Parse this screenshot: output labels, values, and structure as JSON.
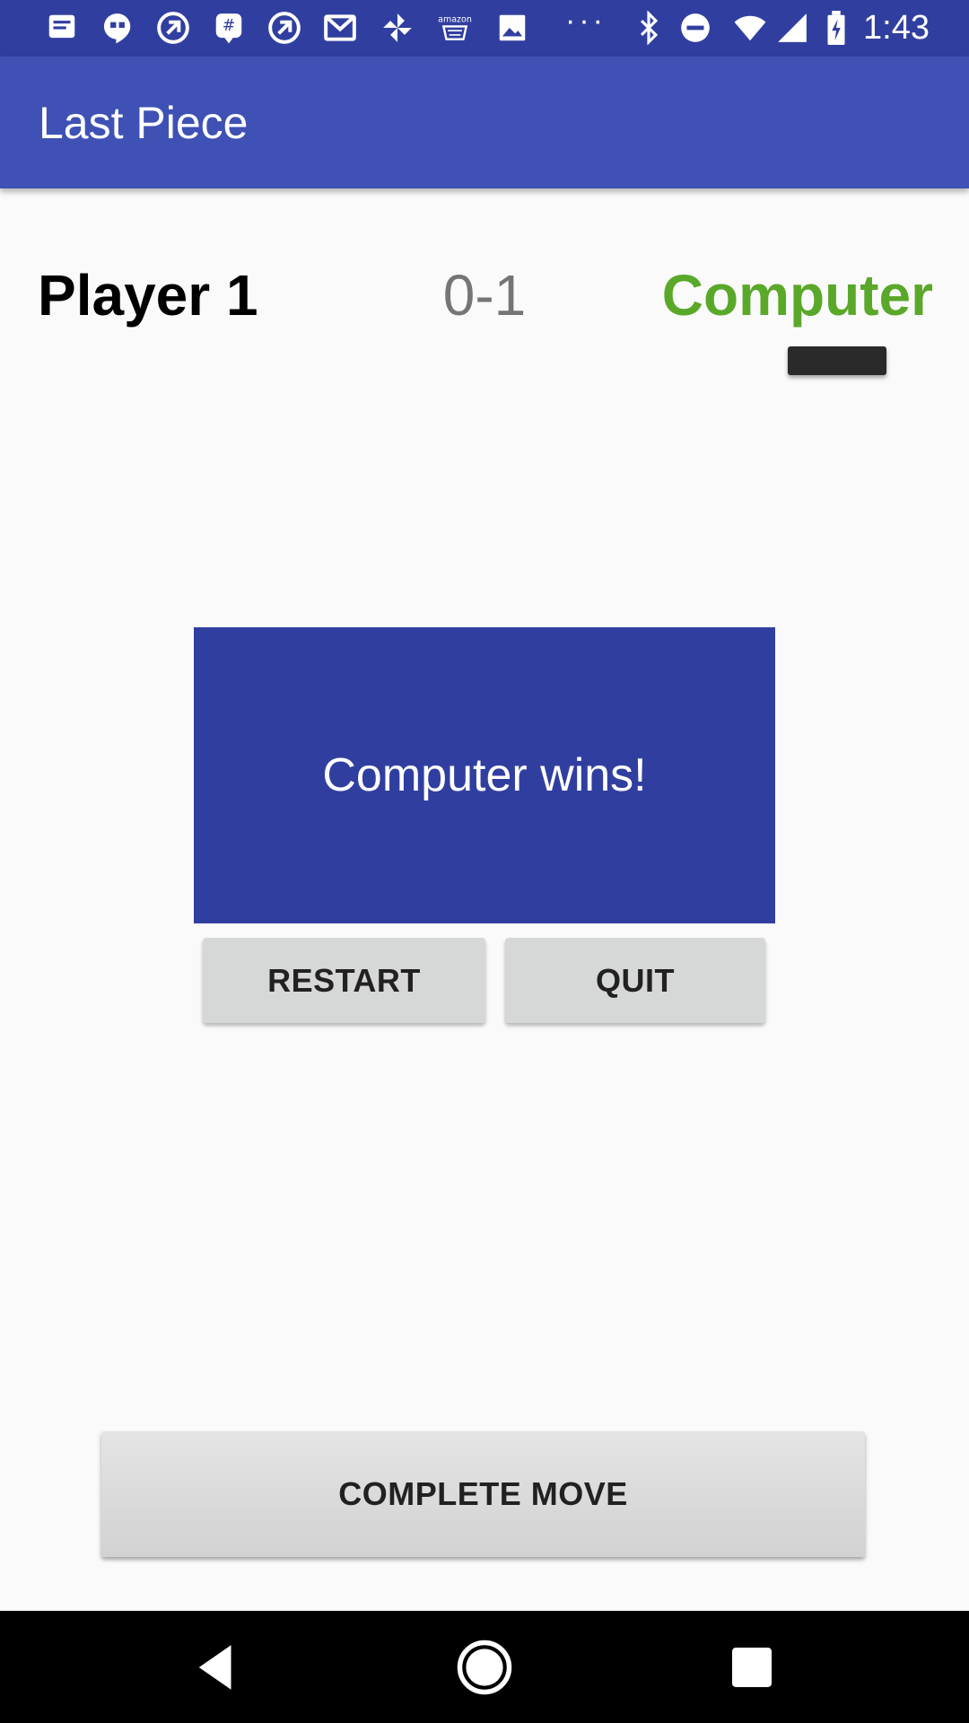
{
  "status_bar": {
    "time": "1:43",
    "overflow": "···",
    "icons": [
      "message-icon",
      "hangouts-icon",
      "app-icon",
      "groupme-icon",
      "app-icon",
      "gmail-icon",
      "pinwheel-icon",
      "amazon-icon",
      "photo-icon",
      "bluetooth-icon",
      "dnd-icon",
      "wifi-icon",
      "signal-icon",
      "battery-icon"
    ]
  },
  "app_bar": {
    "title": "Last Piece"
  },
  "scoreboard": {
    "player": "Player 1",
    "score": "0-1",
    "opponent": "Computer"
  },
  "result": {
    "message": "Computer wins!"
  },
  "actions": {
    "restart": "RESTART",
    "quit": "QUIT",
    "complete_move": "COMPLETE MOVE"
  },
  "colors": {
    "status_bar": "#303f9f",
    "app_bar": "#3f51b5",
    "result_panel": "#303f9f",
    "opponent_name": "#5aa829",
    "score": "#757575"
  },
  "nav_bar": {
    "buttons": [
      "back-icon",
      "home-icon",
      "recents-icon"
    ]
  }
}
